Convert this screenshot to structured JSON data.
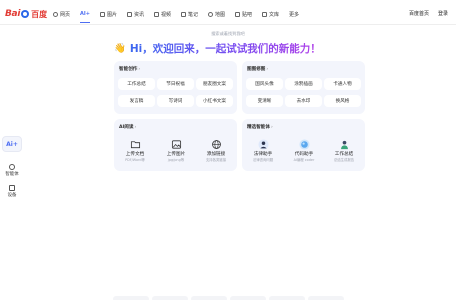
{
  "logo": {
    "text_left": "Bai",
    "text_right": "百度"
  },
  "nav": [
    {
      "label": "网页",
      "icon": "search-icon"
    },
    {
      "label": "AI+",
      "icon": "",
      "active": true
    },
    {
      "label": "图片",
      "icon": "image-icon"
    },
    {
      "label": "资讯",
      "icon": "news-icon"
    },
    {
      "label": "视频",
      "icon": "video-icon"
    },
    {
      "label": "笔记",
      "icon": "note-icon"
    },
    {
      "label": "地图",
      "icon": "map-icon"
    },
    {
      "label": "贴吧",
      "icon": "tieba-icon"
    },
    {
      "label": "文库",
      "icon": "wenku-icon"
    },
    {
      "label": "更多",
      "icon": ""
    }
  ],
  "top_right": {
    "home": "百度首页",
    "login": "登录"
  },
  "hero": {
    "hint": "搜索或着找到我吧",
    "greeting": "Hi，欢迎回来，一起试试我们的新能力！"
  },
  "cards": {
    "smart_create": {
      "title": "智能创作",
      "chips": [
        "工作总结",
        "节日祝福",
        "朋友圈文案",
        "发言稿",
        "写诗词",
        "小红书文案"
      ]
    },
    "image_edit": {
      "title": "图图修图",
      "chips": [
        "国风头像",
        "涂鸦插画",
        "卡通人物",
        "变清晰",
        "去水印",
        "换风格"
      ]
    },
    "ai_read": {
      "title": "AI阅读",
      "tiles": [
        {
          "name": "上传文档",
          "desc": "PDF/Word等",
          "icon": "folder-icon"
        },
        {
          "name": "上传图片",
          "desc": "jpg/png等",
          "icon": "picture-icon"
        },
        {
          "name": "添加链接",
          "desc": "支持各类链接",
          "icon": "globe-link-icon"
        }
      ]
    },
    "agents": {
      "title": "精选智能体",
      "tiles": [
        {
          "name": "法律助手",
          "desc": "法律咨询问题",
          "icon": "lawyer-avatar-icon"
        },
        {
          "name": "代码助手",
          "desc": "AI编程 coder",
          "icon": "code-orb-icon"
        },
        {
          "name": "工作总结",
          "desc": "总结生成报告",
          "icon": "worker-avatar-icon"
        }
      ]
    }
  },
  "rail": {
    "ai_label": "Ai+",
    "items": [
      {
        "label": "智能体",
        "icon": "agent-icon"
      },
      {
        "label": "设备",
        "icon": "device-icon"
      }
    ]
  },
  "colors": {
    "accent": "#4e6ef2",
    "card_bg": "#f3f5fc",
    "logo_red": "#e23c35",
    "logo_blue": "#2b67e8"
  }
}
